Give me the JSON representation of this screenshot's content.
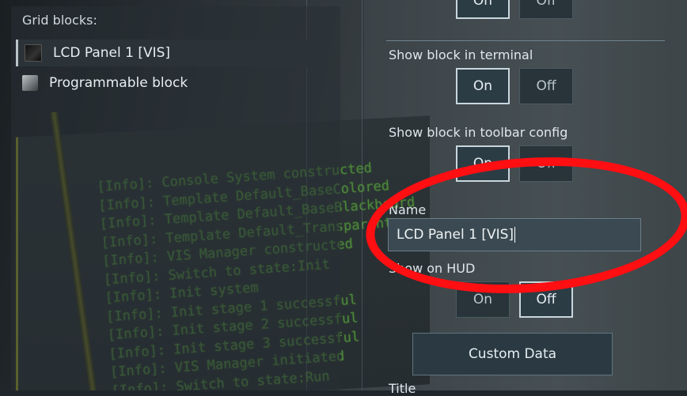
{
  "grid_blocks": {
    "title": "Grid blocks:",
    "items": [
      {
        "label": "LCD Panel 1 [VIS]",
        "icon": "lcd-panel-icon",
        "selected": true
      },
      {
        "label": "Programmable block",
        "icon": "programmable-block-icon",
        "selected": false
      }
    ]
  },
  "console_lines": [
    "[Info]: Console System constructed",
    "[Info]: Template Default_BaseColored",
    "[Info]: Template Default_BaseBlackboard",
    "[Info]: Template Default_Transparent",
    "[Info]: VIS Manager constructed",
    "[Info]: Switch to state:Init",
    "[Info]: Init system",
    "[Info]: Init stage 1 successful",
    "[Info]: Init stage 2 successful",
    "[Info]: Init stage 3 successful",
    "[Info]: VIS Manager initiated",
    "[Info]: Switch to state:Run"
  ],
  "properties": {
    "top_toggle": {
      "on": "On",
      "off": "Off"
    },
    "show_in_terminal": {
      "label": "Show block in terminal",
      "on": "On",
      "off": "Off",
      "value": "On"
    },
    "show_in_toolbar": {
      "label": "Show block in toolbar config",
      "on": "On",
      "off": "Off",
      "value": "On"
    },
    "name": {
      "label": "Name",
      "value": "LCD Panel 1 [VIS]"
    },
    "show_on_hud": {
      "label": "Show on HUD",
      "on": "On",
      "off": "Off",
      "value": "Off"
    },
    "custom_data_button": "Custom Data",
    "title_label": "Title"
  },
  "annotation": {
    "color": "#ff0e12",
    "shape": "ellipse"
  }
}
